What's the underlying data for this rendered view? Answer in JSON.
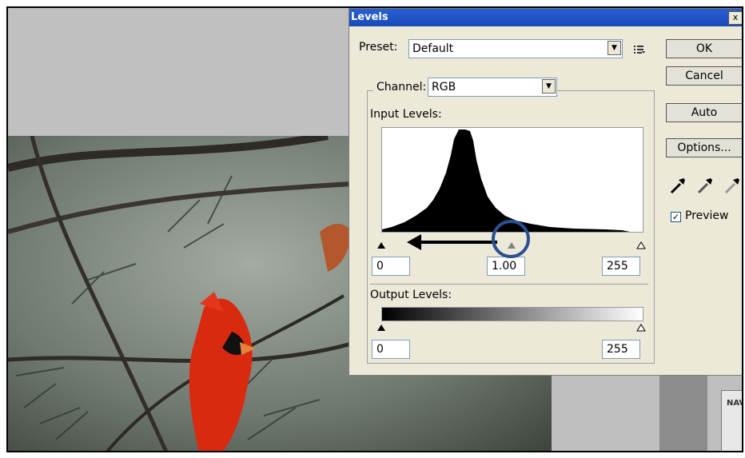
{
  "dialog": {
    "title": "Levels",
    "close_label": "x",
    "preset_label": "Preset:",
    "preset_value": "Default",
    "channel_label": "Channel:",
    "channel_value": "RGB",
    "input_levels_label": "Input Levels:",
    "input_black": "0",
    "input_gamma": "1.00",
    "input_white": "255",
    "output_levels_label": "Output Levels:",
    "output_black": "0",
    "output_white": "255",
    "buttons": {
      "ok": "OK",
      "cancel": "Cancel",
      "auto": "Auto",
      "options": "Options..."
    },
    "preview_label": "Preview",
    "preview_checked": "✓"
  },
  "navigator": {
    "label": "NAV"
  }
}
